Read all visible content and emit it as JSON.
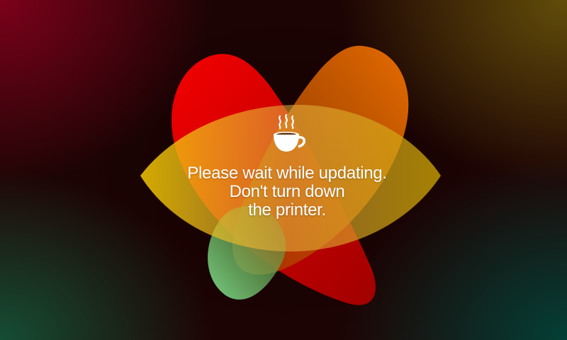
{
  "screen": {
    "icon": "coffee-cup-icon",
    "message_lines": [
      "Please wait while updating.",
      "Don't turn down",
      "the printer."
    ]
  },
  "colors": {
    "petal_red": "#e00000",
    "petal_orange": "#d96a00",
    "petal_yellow": "#e8c000",
    "petal_green": "#6fc47a",
    "text": "#ffffff"
  }
}
